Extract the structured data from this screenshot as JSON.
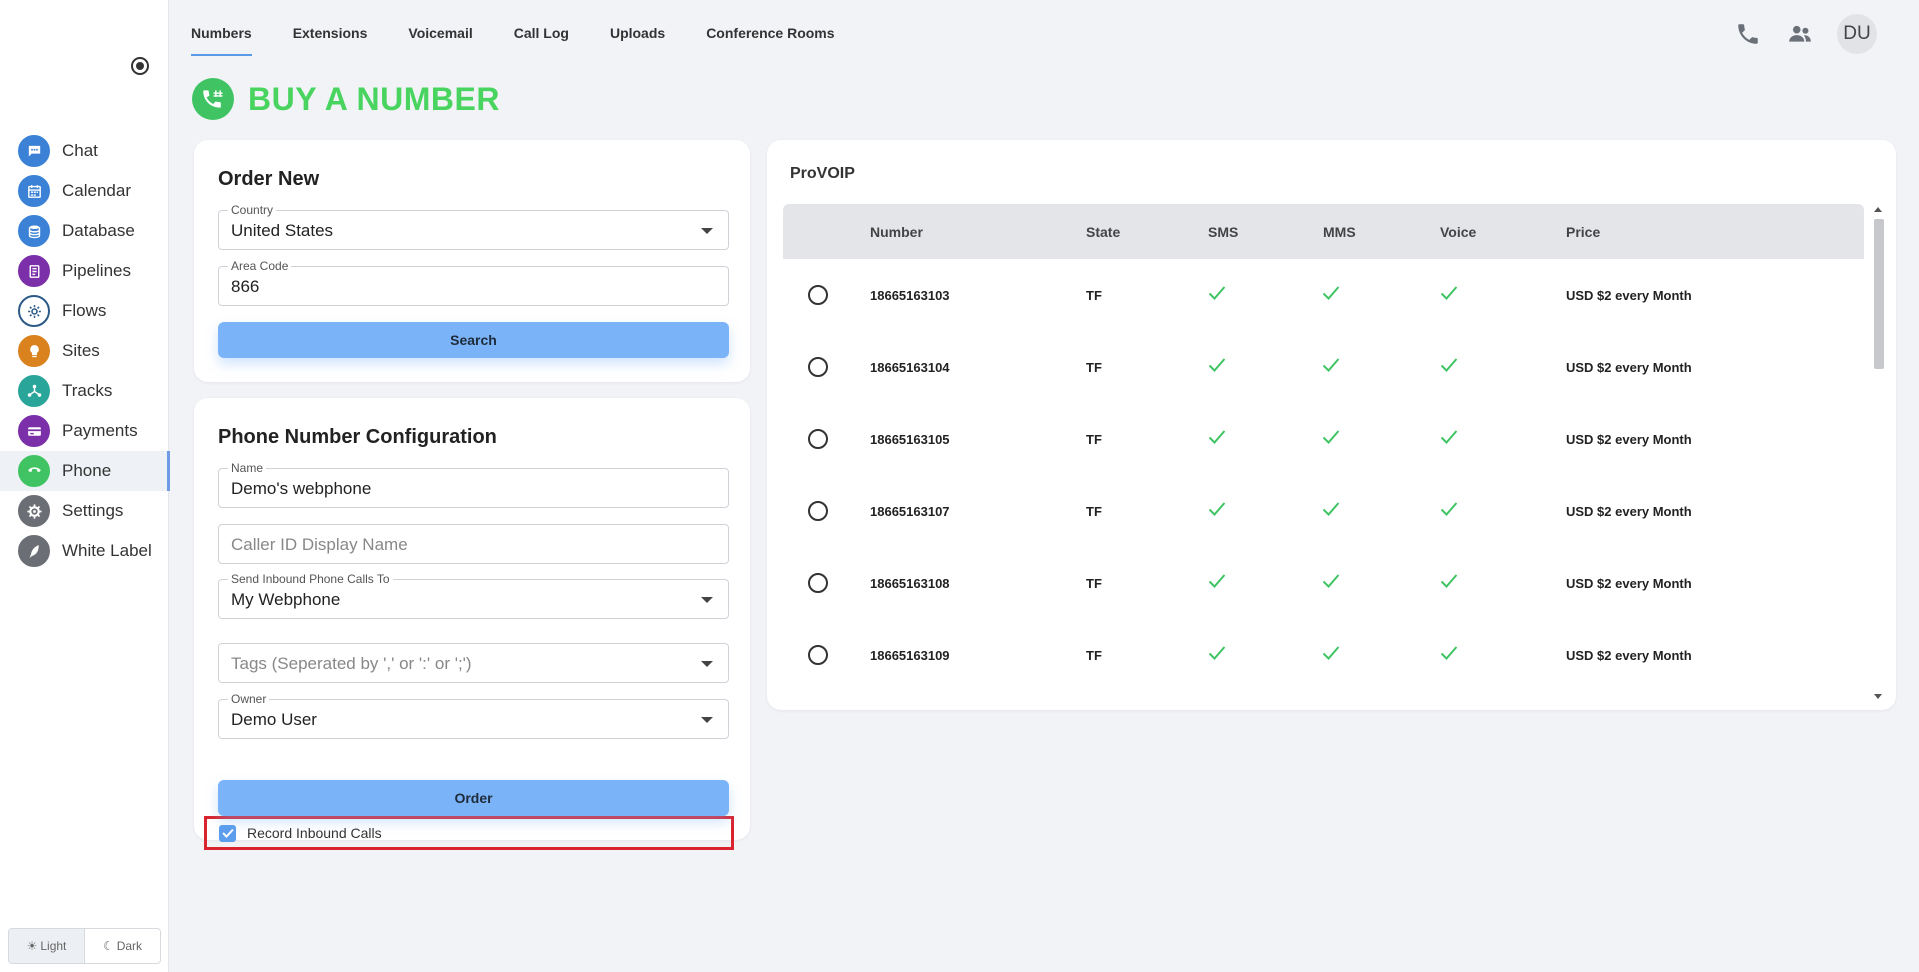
{
  "colors": {
    "accent_blue": "#7bb3f8",
    "brand_green": "#49d460",
    "highlight_red": "#d9232e",
    "check_green": "#40c463"
  },
  "sidebar": {
    "items": [
      {
        "label": "Chat",
        "icon": "chat-icon",
        "color": "#3b82d6"
      },
      {
        "label": "Calendar",
        "icon": "calendar-icon",
        "color": "#3b82d6"
      },
      {
        "label": "Database",
        "icon": "database-icon",
        "color": "#3b82d6"
      },
      {
        "label": "Pipelines",
        "icon": "pipelines-icon",
        "color": "#7b2fa8"
      },
      {
        "label": "Flows",
        "icon": "flows-icon",
        "color": "#2c5a87"
      },
      {
        "label": "Sites",
        "icon": "sites-icon",
        "color": "#d9821e"
      },
      {
        "label": "Tracks",
        "icon": "tracks-icon",
        "color": "#2aa59a"
      },
      {
        "label": "Payments",
        "icon": "payments-icon",
        "color": "#7b2fa8"
      },
      {
        "label": "Phone",
        "icon": "phone-icon",
        "color": "#40c463"
      },
      {
        "label": "Settings",
        "icon": "settings-icon",
        "color": "#6b6f75"
      },
      {
        "label": "White Label",
        "icon": "white-label-icon",
        "color": "#6b6f75"
      }
    ],
    "active": "Phone",
    "theme": {
      "light": "Light",
      "dark": "Dark"
    }
  },
  "topnav": {
    "tabs": [
      "Numbers",
      "Extensions",
      "Voicemail",
      "Call Log",
      "Uploads",
      "Conference Rooms"
    ],
    "active": "Numbers",
    "avatar": "DU"
  },
  "page": {
    "title": "BUY A NUMBER"
  },
  "order_new": {
    "title": "Order New",
    "country_label": "Country",
    "country_value": "United States",
    "area_code_label": "Area Code",
    "area_code_value": "866",
    "search_button": "Search"
  },
  "config": {
    "title": "Phone Number Configuration",
    "name_label": "Name",
    "name_value": "Demo's webphone",
    "caller_id_placeholder": "Caller ID Display Name",
    "send_to_label": "Send Inbound Phone Calls To",
    "send_to_value": "My Webphone",
    "tags_placeholder": "Tags (Seperated by ',' or ':' or ';')",
    "owner_label": "Owner",
    "owner_value": "Demo User",
    "record_label": "Record Inbound Calls",
    "record_checked": true,
    "order_button": "Order"
  },
  "numbers_table": {
    "provider": "ProVOIP",
    "columns": [
      "Number",
      "State",
      "SMS",
      "MMS",
      "Voice",
      "Price"
    ],
    "rows": [
      {
        "number": "18665163103",
        "state": "TF",
        "sms": true,
        "mms": true,
        "voice": true,
        "price": "USD $2 every Month"
      },
      {
        "number": "18665163104",
        "state": "TF",
        "sms": true,
        "mms": true,
        "voice": true,
        "price": "USD $2 every Month"
      },
      {
        "number": "18665163105",
        "state": "TF",
        "sms": true,
        "mms": true,
        "voice": true,
        "price": "USD $2 every Month"
      },
      {
        "number": "18665163107",
        "state": "TF",
        "sms": true,
        "mms": true,
        "voice": true,
        "price": "USD $2 every Month"
      },
      {
        "number": "18665163108",
        "state": "TF",
        "sms": true,
        "mms": true,
        "voice": true,
        "price": "USD $2 every Month"
      },
      {
        "number": "18665163109",
        "state": "TF",
        "sms": true,
        "mms": true,
        "voice": true,
        "price": "USD $2 every Month"
      }
    ]
  }
}
